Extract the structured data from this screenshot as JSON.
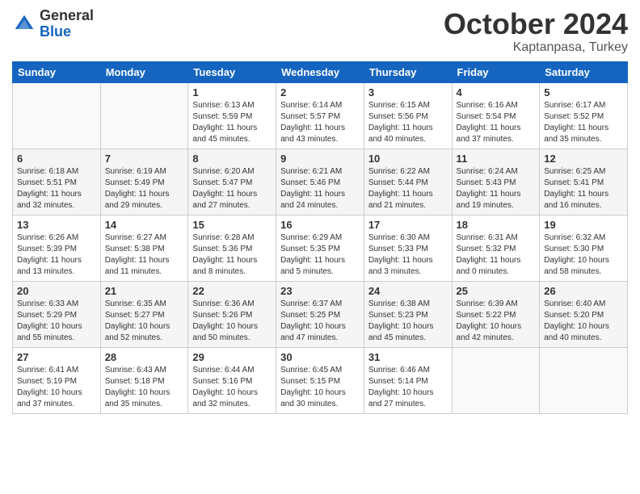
{
  "header": {
    "logo_general": "General",
    "logo_blue": "Blue",
    "month_title": "October 2024",
    "subtitle": "Kaptanpasa, Turkey"
  },
  "days_of_week": [
    "Sunday",
    "Monday",
    "Tuesday",
    "Wednesday",
    "Thursday",
    "Friday",
    "Saturday"
  ],
  "weeks": [
    [
      {
        "day": "",
        "sunrise": "",
        "sunset": "",
        "daylight": ""
      },
      {
        "day": "",
        "sunrise": "",
        "sunset": "",
        "daylight": ""
      },
      {
        "day": "1",
        "sunrise": "Sunrise: 6:13 AM",
        "sunset": "Sunset: 5:59 PM",
        "daylight": "Daylight: 11 hours and 45 minutes."
      },
      {
        "day": "2",
        "sunrise": "Sunrise: 6:14 AM",
        "sunset": "Sunset: 5:57 PM",
        "daylight": "Daylight: 11 hours and 43 minutes."
      },
      {
        "day": "3",
        "sunrise": "Sunrise: 6:15 AM",
        "sunset": "Sunset: 5:56 PM",
        "daylight": "Daylight: 11 hours and 40 minutes."
      },
      {
        "day": "4",
        "sunrise": "Sunrise: 6:16 AM",
        "sunset": "Sunset: 5:54 PM",
        "daylight": "Daylight: 11 hours and 37 minutes."
      },
      {
        "day": "5",
        "sunrise": "Sunrise: 6:17 AM",
        "sunset": "Sunset: 5:52 PM",
        "daylight": "Daylight: 11 hours and 35 minutes."
      }
    ],
    [
      {
        "day": "6",
        "sunrise": "Sunrise: 6:18 AM",
        "sunset": "Sunset: 5:51 PM",
        "daylight": "Daylight: 11 hours and 32 minutes."
      },
      {
        "day": "7",
        "sunrise": "Sunrise: 6:19 AM",
        "sunset": "Sunset: 5:49 PM",
        "daylight": "Daylight: 11 hours and 29 minutes."
      },
      {
        "day": "8",
        "sunrise": "Sunrise: 6:20 AM",
        "sunset": "Sunset: 5:47 PM",
        "daylight": "Daylight: 11 hours and 27 minutes."
      },
      {
        "day": "9",
        "sunrise": "Sunrise: 6:21 AM",
        "sunset": "Sunset: 5:46 PM",
        "daylight": "Daylight: 11 hours and 24 minutes."
      },
      {
        "day": "10",
        "sunrise": "Sunrise: 6:22 AM",
        "sunset": "Sunset: 5:44 PM",
        "daylight": "Daylight: 11 hours and 21 minutes."
      },
      {
        "day": "11",
        "sunrise": "Sunrise: 6:24 AM",
        "sunset": "Sunset: 5:43 PM",
        "daylight": "Daylight: 11 hours and 19 minutes."
      },
      {
        "day": "12",
        "sunrise": "Sunrise: 6:25 AM",
        "sunset": "Sunset: 5:41 PM",
        "daylight": "Daylight: 11 hours and 16 minutes."
      }
    ],
    [
      {
        "day": "13",
        "sunrise": "Sunrise: 6:26 AM",
        "sunset": "Sunset: 5:39 PM",
        "daylight": "Daylight: 11 hours and 13 minutes."
      },
      {
        "day": "14",
        "sunrise": "Sunrise: 6:27 AM",
        "sunset": "Sunset: 5:38 PM",
        "daylight": "Daylight: 11 hours and 11 minutes."
      },
      {
        "day": "15",
        "sunrise": "Sunrise: 6:28 AM",
        "sunset": "Sunset: 5:36 PM",
        "daylight": "Daylight: 11 hours and 8 minutes."
      },
      {
        "day": "16",
        "sunrise": "Sunrise: 6:29 AM",
        "sunset": "Sunset: 5:35 PM",
        "daylight": "Daylight: 11 hours and 5 minutes."
      },
      {
        "day": "17",
        "sunrise": "Sunrise: 6:30 AM",
        "sunset": "Sunset: 5:33 PM",
        "daylight": "Daylight: 11 hours and 3 minutes."
      },
      {
        "day": "18",
        "sunrise": "Sunrise: 6:31 AM",
        "sunset": "Sunset: 5:32 PM",
        "daylight": "Daylight: 11 hours and 0 minutes."
      },
      {
        "day": "19",
        "sunrise": "Sunrise: 6:32 AM",
        "sunset": "Sunset: 5:30 PM",
        "daylight": "Daylight: 10 hours and 58 minutes."
      }
    ],
    [
      {
        "day": "20",
        "sunrise": "Sunrise: 6:33 AM",
        "sunset": "Sunset: 5:29 PM",
        "daylight": "Daylight: 10 hours and 55 minutes."
      },
      {
        "day": "21",
        "sunrise": "Sunrise: 6:35 AM",
        "sunset": "Sunset: 5:27 PM",
        "daylight": "Daylight: 10 hours and 52 minutes."
      },
      {
        "day": "22",
        "sunrise": "Sunrise: 6:36 AM",
        "sunset": "Sunset: 5:26 PM",
        "daylight": "Daylight: 10 hours and 50 minutes."
      },
      {
        "day": "23",
        "sunrise": "Sunrise: 6:37 AM",
        "sunset": "Sunset: 5:25 PM",
        "daylight": "Daylight: 10 hours and 47 minutes."
      },
      {
        "day": "24",
        "sunrise": "Sunrise: 6:38 AM",
        "sunset": "Sunset: 5:23 PM",
        "daylight": "Daylight: 10 hours and 45 minutes."
      },
      {
        "day": "25",
        "sunrise": "Sunrise: 6:39 AM",
        "sunset": "Sunset: 5:22 PM",
        "daylight": "Daylight: 10 hours and 42 minutes."
      },
      {
        "day": "26",
        "sunrise": "Sunrise: 6:40 AM",
        "sunset": "Sunset: 5:20 PM",
        "daylight": "Daylight: 10 hours and 40 minutes."
      }
    ],
    [
      {
        "day": "27",
        "sunrise": "Sunrise: 6:41 AM",
        "sunset": "Sunset: 5:19 PM",
        "daylight": "Daylight: 10 hours and 37 minutes."
      },
      {
        "day": "28",
        "sunrise": "Sunrise: 6:43 AM",
        "sunset": "Sunset: 5:18 PM",
        "daylight": "Daylight: 10 hours and 35 minutes."
      },
      {
        "day": "29",
        "sunrise": "Sunrise: 6:44 AM",
        "sunset": "Sunset: 5:16 PM",
        "daylight": "Daylight: 10 hours and 32 minutes."
      },
      {
        "day": "30",
        "sunrise": "Sunrise: 6:45 AM",
        "sunset": "Sunset: 5:15 PM",
        "daylight": "Daylight: 10 hours and 30 minutes."
      },
      {
        "day": "31",
        "sunrise": "Sunrise: 6:46 AM",
        "sunset": "Sunset: 5:14 PM",
        "daylight": "Daylight: 10 hours and 27 minutes."
      },
      {
        "day": "",
        "sunrise": "",
        "sunset": "",
        "daylight": ""
      },
      {
        "day": "",
        "sunrise": "",
        "sunset": "",
        "daylight": ""
      }
    ]
  ]
}
